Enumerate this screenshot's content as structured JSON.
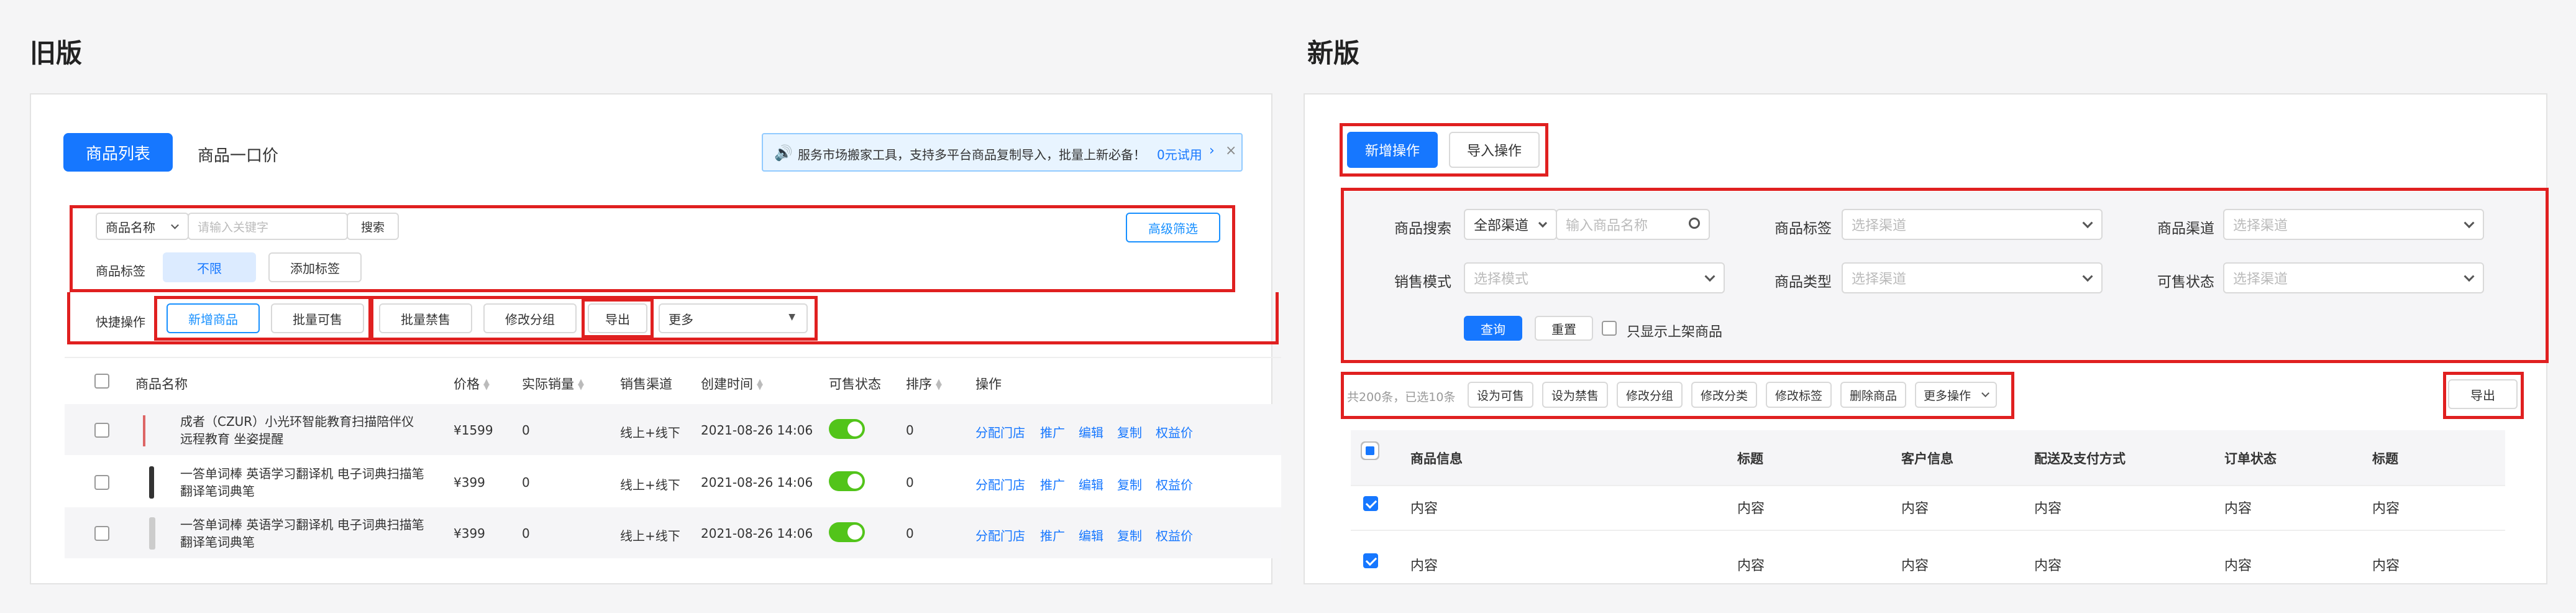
{
  "old": {
    "section_title": "旧版",
    "tabs": [
      {
        "label": "商品列表",
        "active": true
      },
      {
        "label": "商品一口价",
        "active": false
      }
    ],
    "notice": {
      "text": "服务市场搬家工具，支持多平台商品复制导入，批量上新必备！",
      "link": "0元试用"
    },
    "filter": {
      "field_select": "商品名称",
      "search_placeholder": "请输入关键字",
      "search_button": "搜索",
      "advanced": "高级筛选",
      "tag_label": "商品标签",
      "tag_all": "不限",
      "tag_add": "添加标签"
    },
    "quick": {
      "label": "快捷操作",
      "add": "新增商品",
      "batch_sell": "批量可售",
      "batch_ban": "批量禁售",
      "modify_group": "修改分组",
      "export": "导出",
      "more": "更多"
    },
    "table": {
      "headers": [
        "商品名称",
        "价格",
        "实际销量",
        "销售渠道",
        "创建时间",
        "可售状态",
        "排序",
        "操作"
      ],
      "rows": [
        {
          "name": "成者（CZUR）小光环智能教育扫描陪伴仪 远程教育 坐姿提醒",
          "price": "¥1599",
          "sales": "0",
          "channel": "线上+线下",
          "created": "2021-08-26 14:06",
          "sort": "0"
        },
        {
          "name": "一答单词棒 英语学习翻译机 电子词典扫描笔翻译笔词典笔",
          "price": "¥399",
          "sales": "0",
          "channel": "线上+线下",
          "created": "2021-08-26 14:06",
          "sort": "0"
        },
        {
          "name": "一答单词棒 英语学习翻译机 电子词典扫描笔翻译笔词典笔",
          "price": "¥399",
          "sales": "0",
          "channel": "线上+线下",
          "created": "2021-08-26 14:06",
          "sort": "0"
        }
      ],
      "actions": [
        "分配门店",
        "推广",
        "编辑",
        "复制",
        "权益价"
      ]
    }
  },
  "new": {
    "section_title": "新版",
    "top_buttons": {
      "add": "新增操作",
      "import": "导入操作"
    },
    "filters": {
      "search_label": "商品搜索",
      "channel_all": "全部渠道",
      "search_placeholder": "输入商品名称",
      "tag_label": "商品标签",
      "channel_placeholder": "选择渠道",
      "channel_label": "商品渠道",
      "mode_label": "销售模式",
      "mode_placeholder": "选择模式",
      "type_label": "商品类型",
      "status_label": "可售状态",
      "query": "查询",
      "reset": "重置",
      "only_on_shelf": "只显示上架商品"
    },
    "batch": {
      "summary": "共200条，已选10条",
      "set_sellable": "设为可售",
      "set_ban": "设为禁售",
      "modify_group": "修改分组",
      "modify_category": "修改分类",
      "modify_tag": "修改标签",
      "delete": "删除商品",
      "more": "更多操作",
      "export": "导出"
    },
    "table": {
      "headers": [
        "商品信息",
        "标题",
        "客户信息",
        "配送及支付方式",
        "订单状态",
        "标题"
      ],
      "row1": [
        "内容",
        "内容",
        "内容",
        "内容",
        "内容",
        "内容"
      ],
      "row2": [
        "内容",
        "内容",
        "内容",
        "内容",
        "内容",
        "内容"
      ]
    }
  },
  "colors": {
    "accent": "#1677ff",
    "highlight": "#e02020",
    "toggle": "#52c41a"
  }
}
